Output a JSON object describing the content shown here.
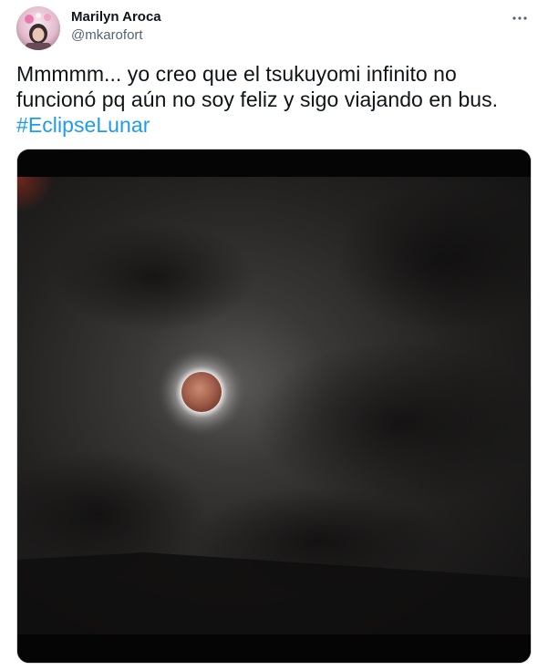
{
  "tweet": {
    "author": {
      "display_name": "Marilyn Aroca",
      "handle": "@mkarofort"
    },
    "text_line1": "Mmmmm... yo creo que el tsukuyomi infinito no",
    "text_line2": "funcionó pq aún no soy feliz y sigo viajando en bus.",
    "hashtag": "#EclipseLunar",
    "more_icon": "more-horizontal-icon",
    "media": {
      "description": "photo-lunar-eclipse"
    }
  },
  "colors": {
    "text": "#0f1419",
    "secondary": "#536471",
    "link": "#1d9bf0",
    "border": "#cfd9de"
  }
}
